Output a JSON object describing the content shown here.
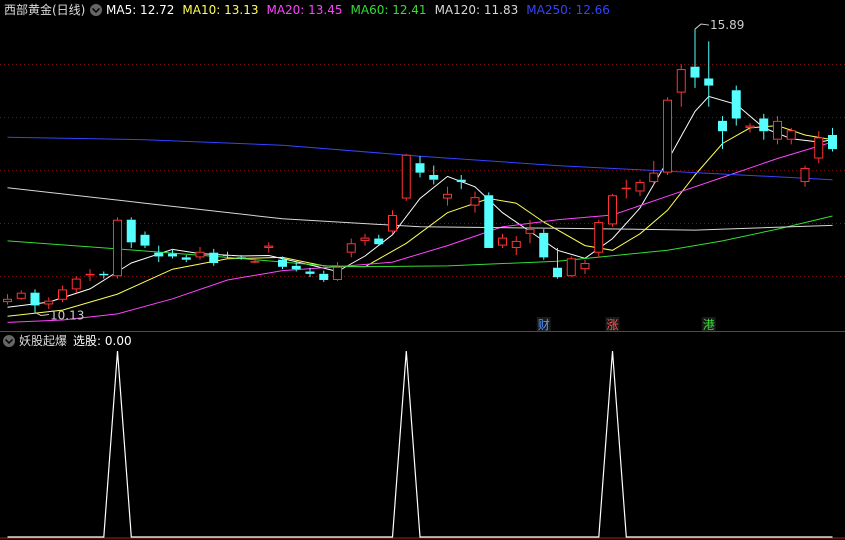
{
  "main_panel": {
    "title": "西部黄金(日线)",
    "ma_labels": [
      {
        "text": "MA5: 12.72",
        "color": "#ffffff"
      },
      {
        "text": "MA10: 13.13",
        "color": "#ffff55"
      },
      {
        "text": "MA20: 13.45",
        "color": "#ff44ff"
      },
      {
        "text": "MA60: 12.41",
        "color": "#33dd33"
      },
      {
        "text": "MA120: 11.83",
        "color": "#d8d8d8"
      },
      {
        "text": "MA250: 12.66",
        "color": "#3344ff"
      }
    ],
    "high_label": "15.89",
    "low_label": "10.13",
    "markers": [
      {
        "text": "财",
        "color": "#5599ff",
        "bar": 39
      },
      {
        "text": "涨",
        "color": "#ff5555",
        "bar": 44
      },
      {
        "text": "港",
        "color": "#33dd33",
        "bar": 51
      }
    ]
  },
  "sub_panel": {
    "title": "妖股起爆",
    "value_label": "选股: 0.00"
  },
  "colors": {
    "up": "#ff3333",
    "down": "#55ffff",
    "grid": "#7a1010",
    "separator": "#aa2222"
  },
  "chart_data": [
    {
      "type": "candlestick",
      "title": "西部黄金(日线)",
      "ylim": [
        9.8,
        16.3
      ],
      "candles": [
        [
          10.35,
          10.52,
          10.3,
          10.42
        ],
        [
          10.42,
          10.6,
          10.4,
          10.55
        ],
        [
          10.55,
          10.62,
          10.13,
          10.28
        ],
        [
          10.3,
          10.45,
          10.2,
          10.38
        ],
        [
          10.4,
          10.7,
          10.35,
          10.62
        ],
        [
          10.62,
          10.9,
          10.55,
          10.85
        ],
        [
          10.92,
          11.05,
          10.8,
          10.95
        ],
        [
          10.95,
          11.0,
          10.85,
          10.92
        ],
        [
          10.9,
          12.15,
          10.85,
          12.1
        ],
        [
          12.1,
          12.15,
          11.5,
          11.62
        ],
        [
          11.78,
          11.85,
          11.5,
          11.55
        ],
        [
          11.4,
          11.55,
          11.2,
          11.32
        ],
        [
          11.38,
          11.48,
          11.28,
          11.32
        ],
        [
          11.3,
          11.35,
          11.2,
          11.25
        ],
        [
          11.3,
          11.52,
          11.25,
          11.42
        ],
        [
          11.4,
          11.48,
          11.12,
          11.18
        ],
        [
          11.35,
          11.42,
          11.28,
          11.33
        ],
        [
          11.3,
          11.35,
          11.25,
          11.28
        ],
        [
          11.22,
          11.28,
          11.18,
          11.22
        ],
        [
          11.5,
          11.62,
          11.4,
          11.55
        ],
        [
          11.25,
          11.32,
          11.05,
          11.1
        ],
        [
          11.12,
          11.22,
          11.0,
          11.05
        ],
        [
          11.0,
          11.08,
          10.88,
          10.95
        ],
        [
          10.95,
          11.02,
          10.78,
          10.82
        ],
        [
          10.82,
          11.2,
          10.8,
          11.1
        ],
        [
          11.4,
          11.7,
          11.3,
          11.6
        ],
        [
          11.65,
          11.8,
          11.55,
          11.72
        ],
        [
          11.7,
          11.78,
          11.55,
          11.58
        ],
        [
          11.85,
          12.3,
          11.8,
          12.2
        ],
        [
          12.55,
          13.5,
          12.5,
          13.48
        ],
        [
          13.3,
          13.45,
          13.0,
          13.1
        ],
        [
          13.05,
          13.25,
          12.85,
          12.95
        ],
        [
          12.55,
          12.8,
          12.4,
          12.65
        ],
        [
          12.95,
          13.05,
          12.75,
          12.9
        ],
        [
          12.4,
          12.7,
          12.25,
          12.58
        ],
        [
          12.62,
          12.68,
          11.5,
          11.5
        ],
        [
          11.55,
          11.8,
          11.5,
          11.72
        ],
        [
          11.5,
          11.75,
          11.35,
          11.65
        ],
        [
          11.8,
          12.1,
          11.6,
          11.9
        ],
        [
          11.82,
          11.9,
          11.25,
          11.3
        ],
        [
          11.08,
          11.5,
          10.85,
          10.88
        ],
        [
          10.9,
          11.32,
          10.88,
          11.28
        ],
        [
          11.05,
          11.25,
          10.95,
          11.18
        ],
        [
          11.4,
          12.1,
          11.3,
          12.05
        ],
        [
          12.0,
          12.65,
          11.95,
          12.62
        ],
        [
          12.75,
          12.95,
          12.55,
          12.78
        ],
        [
          12.7,
          12.95,
          12.6,
          12.9
        ],
        [
          12.9,
          13.35,
          12.85,
          13.1
        ],
        [
          13.1,
          14.7,
          13.05,
          14.65
        ],
        [
          14.8,
          15.4,
          14.5,
          15.3
        ],
        [
          15.35,
          16.15,
          14.9,
          15.12
        ],
        [
          15.1,
          15.89,
          14.5,
          14.95
        ],
        [
          14.2,
          14.3,
          13.6,
          13.98
        ],
        [
          14.85,
          14.95,
          14.1,
          14.25
        ],
        [
          14.05,
          14.15,
          13.95,
          14.1
        ],
        [
          14.25,
          14.35,
          13.8,
          13.98
        ],
        [
          13.8,
          14.3,
          13.7,
          14.2
        ],
        [
          13.8,
          14.05,
          13.7,
          14.0
        ],
        [
          12.9,
          13.25,
          12.8,
          13.2
        ],
        [
          13.4,
          13.98,
          13.3,
          13.85
        ],
        [
          13.9,
          14.05,
          13.55,
          13.6
        ]
      ],
      "ma_lines": [
        {
          "name": "MA5",
          "points": [
            [
              0,
              10.24
            ],
            [
              3,
              10.35
            ],
            [
              6,
              10.63
            ],
            [
              9,
              11.18
            ],
            [
              12,
              11.47
            ],
            [
              14,
              11.38
            ],
            [
              17,
              11.33
            ],
            [
              19,
              11.34
            ],
            [
              22,
              11.14
            ],
            [
              24,
              11.0
            ],
            [
              26,
              11.33
            ],
            [
              28,
              11.78
            ],
            [
              30,
              12.55
            ],
            [
              32,
              13.02
            ],
            [
              34,
              12.8
            ],
            [
              36,
              12.25
            ],
            [
              38,
              11.85
            ],
            [
              40,
              11.45
            ],
            [
              42,
              11.28
            ],
            [
              44,
              11.7
            ],
            [
              46,
              12.35
            ],
            [
              48,
              13.35
            ],
            [
              50,
              14.4
            ],
            [
              51,
              14.72
            ],
            [
              53,
              14.55
            ],
            [
              55,
              14.05
            ],
            [
              57,
              13.82
            ],
            [
              59,
              13.75
            ],
            [
              60,
              13.8
            ]
          ]
        },
        {
          "name": "MA10",
          "points": [
            [
              0,
              10.05
            ],
            [
              4,
              10.18
            ],
            [
              8,
              10.52
            ],
            [
              12,
              11.05
            ],
            [
              16,
              11.27
            ],
            [
              20,
              11.3
            ],
            [
              23,
              11.12
            ],
            [
              26,
              11.1
            ],
            [
              29,
              11.6
            ],
            [
              32,
              12.25
            ],
            [
              35,
              12.55
            ],
            [
              37,
              12.45
            ],
            [
              39,
              12.05
            ],
            [
              42,
              11.55
            ],
            [
              44,
              11.45
            ],
            [
              46,
              11.8
            ],
            [
              48,
              12.3
            ],
            [
              50,
              13.05
            ],
            [
              52,
              13.72
            ],
            [
              54,
              14.05
            ],
            [
              56,
              14.1
            ],
            [
              58,
              13.9
            ],
            [
              60,
              13.8
            ]
          ]
        },
        {
          "name": "MA20",
          "points": [
            [
              0,
              9.92
            ],
            [
              4,
              9.97
            ],
            [
              8,
              10.1
            ],
            [
              12,
              10.42
            ],
            [
              16,
              10.82
            ],
            [
              20,
              11.02
            ],
            [
              24,
              11.1
            ],
            [
              28,
              11.2
            ],
            [
              32,
              11.55
            ],
            [
              36,
              11.95
            ],
            [
              40,
              12.1
            ],
            [
              44,
              12.2
            ],
            [
              48,
              12.6
            ],
            [
              52,
              13.0
            ],
            [
              56,
              13.4
            ],
            [
              60,
              13.75
            ]
          ]
        },
        {
          "name": "MA60",
          "points": [
            [
              0,
              11.65
            ],
            [
              8,
              11.48
            ],
            [
              16,
              11.3
            ],
            [
              24,
              11.1
            ],
            [
              32,
              11.12
            ],
            [
              40,
              11.22
            ],
            [
              48,
              11.45
            ],
            [
              52,
              11.65
            ],
            [
              56,
              11.9
            ],
            [
              60,
              12.18
            ]
          ]
        },
        {
          "name": "MA120",
          "points": [
            [
              0,
              12.78
            ],
            [
              10,
              12.45
            ],
            [
              20,
              12.12
            ],
            [
              30,
              11.95
            ],
            [
              40,
              11.92
            ],
            [
              50,
              11.88
            ],
            [
              60,
              11.98
            ]
          ]
        },
        {
          "name": "MA250",
          "points": [
            [
              0,
              13.85
            ],
            [
              10,
              13.8
            ],
            [
              20,
              13.68
            ],
            [
              30,
              13.45
            ],
            [
              40,
              13.25
            ],
            [
              50,
              13.1
            ],
            [
              60,
              12.95
            ]
          ]
        }
      ]
    },
    {
      "type": "line",
      "title": "妖股起爆",
      "ylim": [
        0,
        1
      ],
      "x": [
        0,
        1,
        2,
        3,
        4,
        5,
        6,
        7,
        8,
        9,
        10,
        11,
        12,
        13,
        14,
        15,
        16,
        17,
        18,
        19,
        20,
        21,
        22,
        23,
        24,
        25,
        26,
        27,
        28,
        29,
        30,
        31,
        32,
        33,
        34,
        35,
        36,
        37,
        38,
        39,
        40,
        41,
        42,
        43,
        44,
        45,
        46,
        47,
        48,
        49,
        50,
        51,
        52,
        53,
        54,
        55,
        56,
        57,
        58,
        59,
        60
      ],
      "values": [
        0,
        0,
        0,
        0,
        0,
        0,
        0,
        0,
        1,
        0,
        0,
        0,
        0,
        0,
        0,
        0,
        0,
        0,
        0,
        0,
        0,
        0,
        0,
        0,
        0,
        0,
        0,
        0,
        0,
        1,
        0,
        0,
        0,
        0,
        0,
        0,
        0,
        0,
        0,
        0,
        0,
        0,
        0,
        0,
        1,
        0,
        0,
        0,
        0,
        0,
        0,
        0,
        0,
        0,
        0,
        0,
        0,
        0,
        0,
        0,
        0
      ]
    }
  ]
}
